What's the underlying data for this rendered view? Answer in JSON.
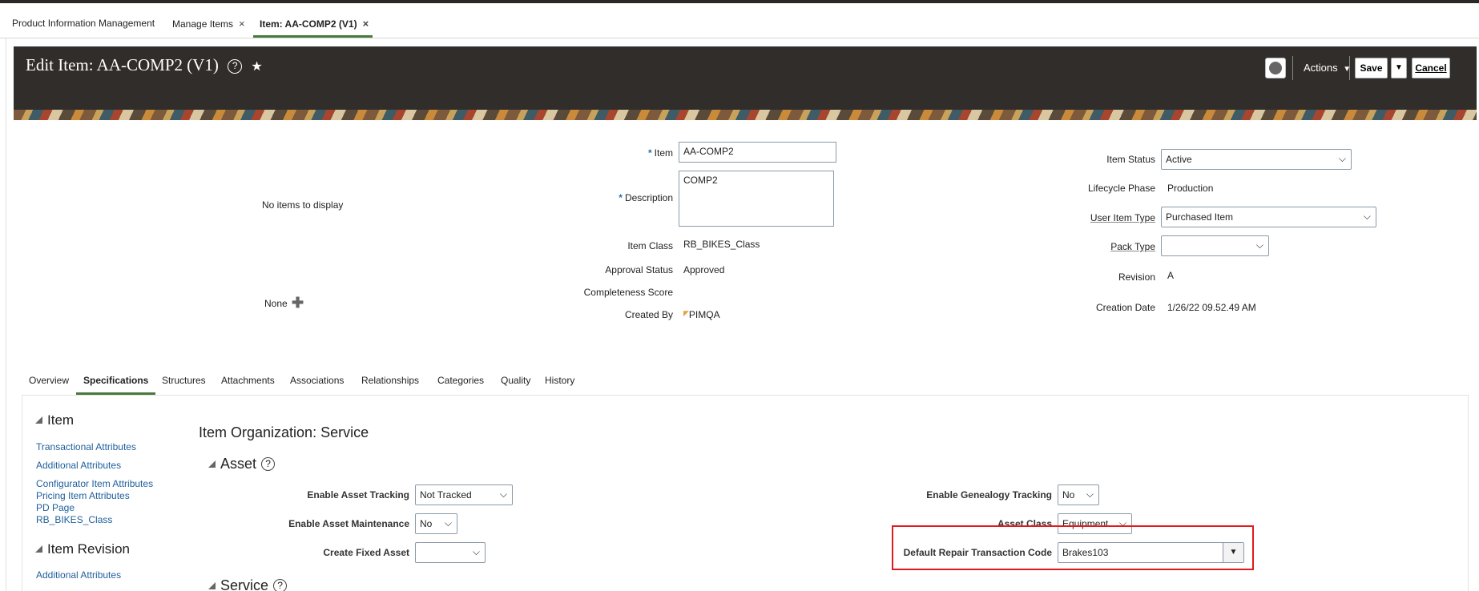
{
  "tabs": [
    {
      "label": "Product Information Management",
      "closable": false
    },
    {
      "label": "Manage Items",
      "closable": true
    },
    {
      "label": "Item: AA-COMP2 (V1)",
      "closable": true
    }
  ],
  "close_glyph": "×",
  "header": {
    "title": "Edit Item: AA-COMP2 (V1)",
    "actions_label": "Actions",
    "save_label": "Save",
    "cancel_label": "Cancel"
  },
  "image_panel": {
    "empty_text": "No items to display",
    "none_label": "None"
  },
  "summary": {
    "item_label": "Item",
    "item_value": "AA-COMP2",
    "description_label": "Description",
    "description_value": "COMP2",
    "item_class_label": "Item Class",
    "item_class_value": "RB_BIKES_Class",
    "approval_status_label": "Approval Status",
    "approval_status_value": "Approved",
    "completeness_label": "Completeness Score",
    "created_by_label": "Created By",
    "created_by_value": "PIMQA",
    "item_status_label": "Item Status",
    "item_status_value": "Active",
    "lifecycle_label": "Lifecycle Phase",
    "lifecycle_value": "Production",
    "user_item_type_label": "User Item Type",
    "user_item_type_value": "Purchased Item",
    "pack_type_label": "Pack Type",
    "pack_type_value": "",
    "revision_label": "Revision",
    "revision_value": "A",
    "creation_date_label": "Creation Date",
    "creation_date_value": "1/26/22 09.52.49 AM"
  },
  "detail_tabs": [
    "Overview",
    "Specifications",
    "Structures",
    "Attachments",
    "Associations",
    "Relationships",
    "Categories",
    "Quality",
    "History"
  ],
  "nav": {
    "item_heading": "Item",
    "item_links": [
      "Transactional Attributes",
      "Additional Attributes",
      "Configurator Item Attributes",
      "Pricing Item Attributes",
      "PD Page",
      "RB_BIKES_Class"
    ],
    "revision_heading": "Item Revision",
    "revision_links": [
      "Additional Attributes"
    ]
  },
  "content": {
    "section_title": "Item Organization: Service",
    "asset_heading": "Asset",
    "service_heading": "Service",
    "enable_asset_tracking_label": "Enable Asset Tracking",
    "enable_asset_tracking_value": "Not Tracked",
    "enable_asset_maintenance_label": "Enable Asset Maintenance",
    "enable_asset_maintenance_value": "No",
    "create_fixed_asset_label": "Create Fixed Asset",
    "create_fixed_asset_value": "",
    "enable_genealogy_label": "Enable Genealogy Tracking",
    "enable_genealogy_value": "No",
    "asset_class_label": "Asset Class",
    "asset_class_value": "Equipment",
    "repair_code_label": "Default Repair Transaction Code",
    "repair_code_value": "Brakes103"
  },
  "colors": {
    "header_bg": "#312d2a",
    "active_tab_underline": "#4a7a3b",
    "link": "#1f5f9b",
    "highlight_border": "#e01b1b"
  }
}
